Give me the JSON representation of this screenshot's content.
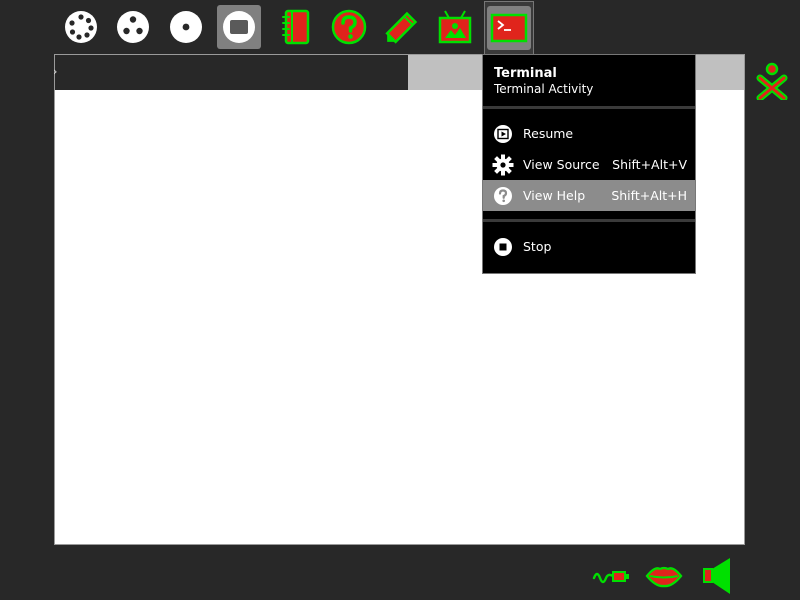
{
  "colors": {
    "background": "#282828",
    "accent_green": "#00e000",
    "accent_red": "#e0241c",
    "highlight": "#8c8c8c",
    "palette_bg": "#000000"
  },
  "toolbar": {
    "items": [
      {
        "icon": "home-view-icon",
        "state": "normal"
      },
      {
        "icon": "group-view-icon",
        "state": "normal"
      },
      {
        "icon": "neighborhood-view-icon",
        "state": "normal"
      },
      {
        "icon": "activity-view-icon",
        "state": "active"
      },
      {
        "icon": "journal-icon",
        "state": "normal"
      },
      {
        "icon": "help-activity-icon",
        "state": "normal"
      },
      {
        "icon": "write-activity-icon",
        "state": "normal"
      },
      {
        "icon": "record-activity-icon",
        "state": "normal"
      },
      {
        "icon": "terminal-activity-icon",
        "state": "selected"
      }
    ]
  },
  "palette": {
    "title": "Terminal",
    "subtitle": "Terminal Activity",
    "items": [
      {
        "label": "Resume",
        "accel": "",
        "icon": "resume-icon"
      },
      {
        "label": "View Source",
        "accel": "Shift+Alt+V",
        "icon": "view-source-gear-icon"
      },
      {
        "label": "View Help",
        "accel": "Shift+Alt+H",
        "icon": "help-icon",
        "highlighted": true
      },
      {
        "label": "Stop",
        "accel": "",
        "icon": "stop-icon"
      }
    ]
  },
  "tray": {
    "items": [
      {
        "icon": "network-cable-icon"
      },
      {
        "icon": "microphone-lips-icon"
      },
      {
        "icon": "speaker-volume-icon"
      }
    ]
  }
}
